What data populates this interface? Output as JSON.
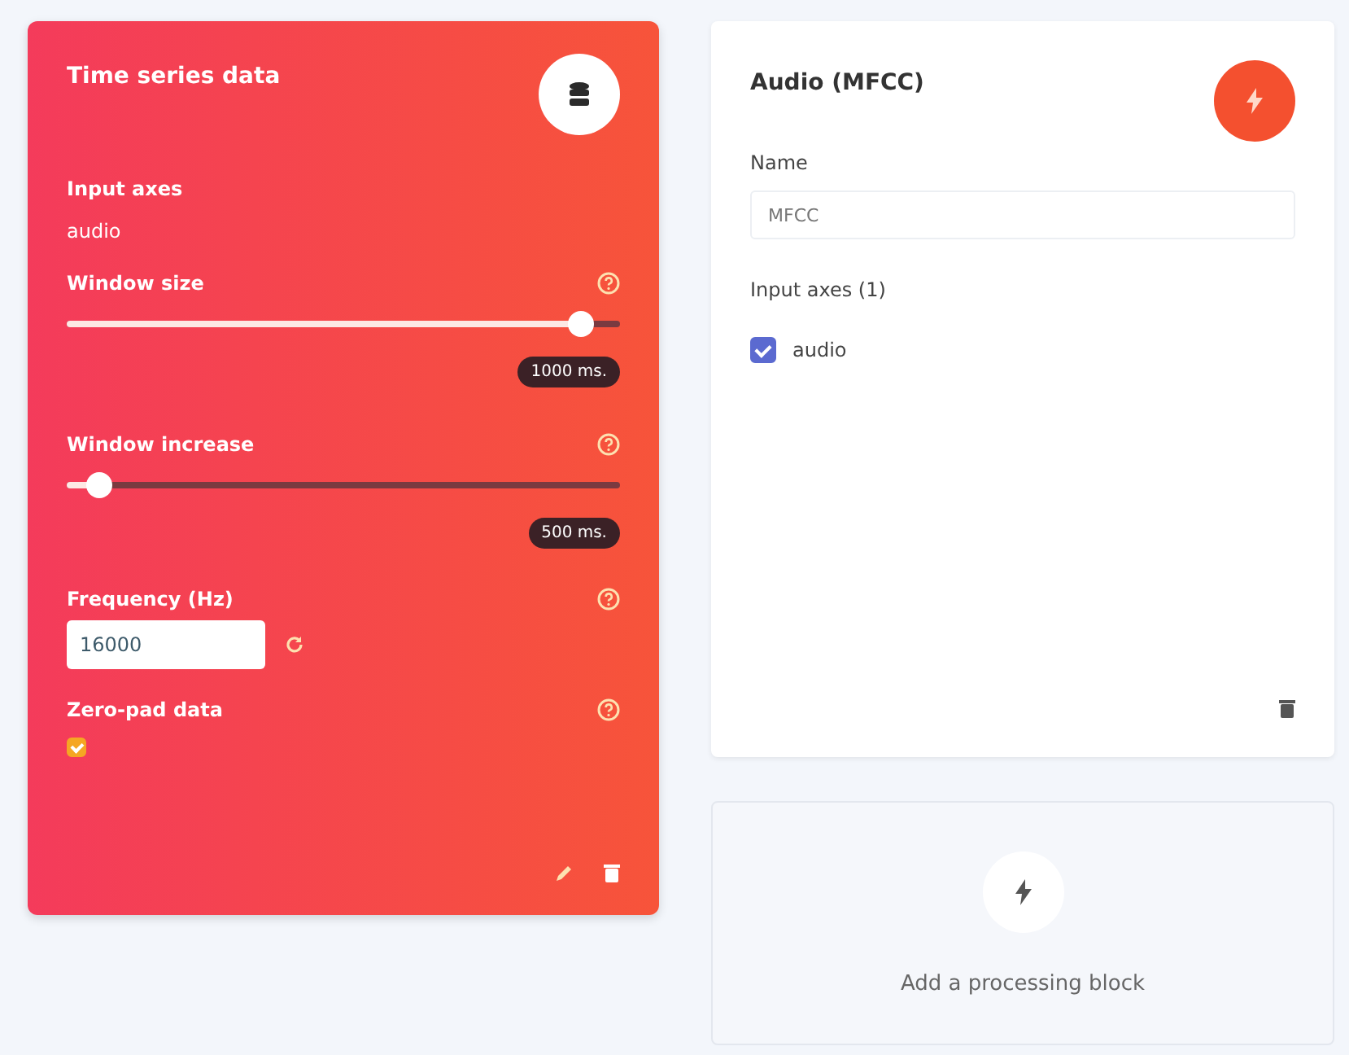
{
  "input_block": {
    "title": "Time series data",
    "axes_label": "Input axes",
    "axes_value": "audio",
    "sliders": [
      {
        "label": "Window size",
        "level": 0.93,
        "reading": "1000 ms."
      },
      {
        "label": "Window increase",
        "level": 0.06,
        "reading": "500 ms."
      }
    ],
    "frequency": {
      "label": "Frequency (Hz)",
      "value": "16000"
    },
    "zero_pad": {
      "label": "Zero-pad data",
      "checked": true
    }
  },
  "processing_block": {
    "title": "Audio (MFCC)",
    "name_label": "Name",
    "name_value": "MFCC",
    "axes_label": "Input axes (1)",
    "axes": [
      {
        "label": "audio",
        "checked": true
      }
    ]
  },
  "add_block": {
    "label": "Add a processing block"
  }
}
